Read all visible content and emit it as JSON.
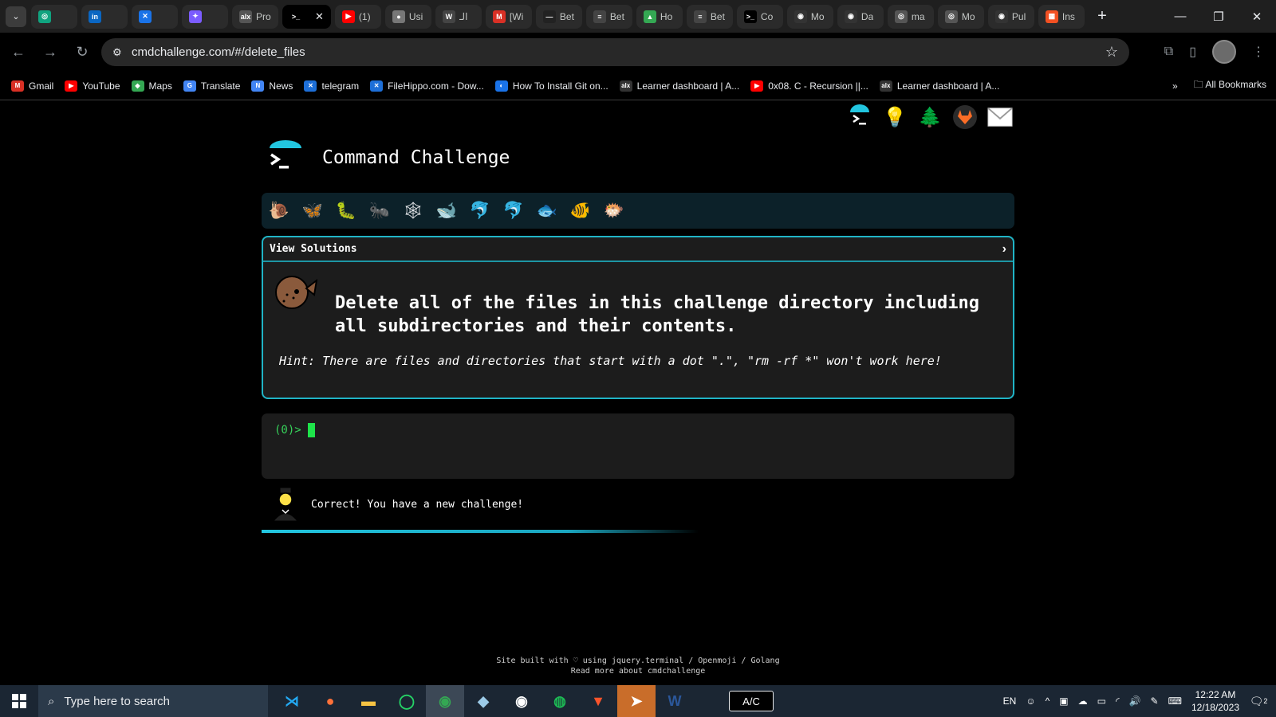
{
  "browser": {
    "tabs": [
      {
        "label": "",
        "fav_color": "#10a37f",
        "fav": "◎"
      },
      {
        "label": "",
        "fav_color": "#0a66c2",
        "fav": "in"
      },
      {
        "label": "",
        "fav_color": "#1a73e8",
        "fav": "✕"
      },
      {
        "label": "",
        "fav_color": "#7b5cff",
        "fav": "✦"
      },
      {
        "label": "Pro",
        "fav_color": "#555555",
        "fav": "alx"
      },
      {
        "label": "",
        "fav_color": "#000000",
        "fav": ">_",
        "active": true
      },
      {
        "label": "(1)",
        "fav_color": "#ff0000",
        "fav": "▶"
      },
      {
        "label": "Usi",
        "fav_color": "#777777",
        "fav": "●"
      },
      {
        "label": "الـ",
        "fav_color": "#444444",
        "fav": "W"
      },
      {
        "label": "[Wi",
        "fav_color": "#d93025",
        "fav": "M"
      },
      {
        "label": "Bet",
        "fav_color": "#222222",
        "fav": "—"
      },
      {
        "label": "Bet",
        "fav_color": "#444444",
        "fav": "≡"
      },
      {
        "label": "Ho",
        "fav_color": "#34a853",
        "fav": "▲"
      },
      {
        "label": "Bet",
        "fav_color": "#444444",
        "fav": "≡"
      },
      {
        "label": "Co",
        "fav_color": "#000000",
        "fav": ">_"
      },
      {
        "label": "Mo",
        "fav_color": "#333333",
        "fav": "◉"
      },
      {
        "label": "Da",
        "fav_color": "#333333",
        "fav": "◉"
      },
      {
        "label": "ma",
        "fav_color": "#555555",
        "fav": "◎"
      },
      {
        "label": "Mo",
        "fav_color": "#555555",
        "fav": "◎"
      },
      {
        "label": "Pul",
        "fav_color": "#333333",
        "fav": "◉"
      },
      {
        "label": "Ins",
        "fav_color": "#f25022",
        "fav": "▦"
      }
    ],
    "active_tab_close": "✕",
    "new_tab": "+",
    "url": "cmdchallenge.com/#/delete_files",
    "bookmarks": [
      {
        "label": "Gmail",
        "fav_color": "#d93025",
        "fav": "M"
      },
      {
        "label": "YouTube",
        "fav_color": "#ff0000",
        "fav": "▶"
      },
      {
        "label": "Maps",
        "fav_color": "#34a853",
        "fav": "◆"
      },
      {
        "label": "Translate",
        "fav_color": "#4285f4",
        "fav": "G"
      },
      {
        "label": "News",
        "fav_color": "#4285f4",
        "fav": "N"
      },
      {
        "label": "telegram",
        "fav_color": "#1d6fd8",
        "fav": "✕"
      },
      {
        "label": "FileHippo.com - Dow...",
        "fav_color": "#1d6fd8",
        "fav": "✕"
      },
      {
        "label": "How To Install Git on...",
        "fav_color": "#1a73e8",
        "fav": "◐"
      },
      {
        "label": "Learner dashboard | A...",
        "fav_color": "#333333",
        "fav": "alx"
      },
      {
        "label": "0x08. C - Recursion ||...",
        "fav_color": "#ff0000",
        "fav": "▶"
      },
      {
        "label": "Learner dashboard | A...",
        "fav_color": "#333333",
        "fav": "alx"
      }
    ],
    "all_bookmarks": "All Bookmarks"
  },
  "page": {
    "title": "Command Challenge",
    "view_solutions": "View Solutions",
    "challenge_text": "Delete all of the files in this challenge directory including all subdirectories and their contents.",
    "hint": "Hint: There are files and directories that start with a dot \".\", \"rm -rf *\" won't work here!",
    "prompt": "(0)>",
    "result": "Correct! You have a new challenge!",
    "progress_fraction": 0.58,
    "footer_line1": "Site built with ♡ using jquery.terminal / Openmoji / Golang",
    "footer_line2": "Read more about cmdchallenge",
    "emoji_bar": [
      "🐌",
      "🦋",
      "🐛",
      "🐜",
      "🕸",
      "🐋",
      "🐬",
      "🐬",
      "🐟",
      "🐠",
      "🐡"
    ]
  },
  "taskbar": {
    "search_placeholder": "Type here to search",
    "ac_label": "A/C",
    "lang": "EN",
    "time": "12:22 AM",
    "date": "12/18/2023",
    "notif_count": "2"
  }
}
